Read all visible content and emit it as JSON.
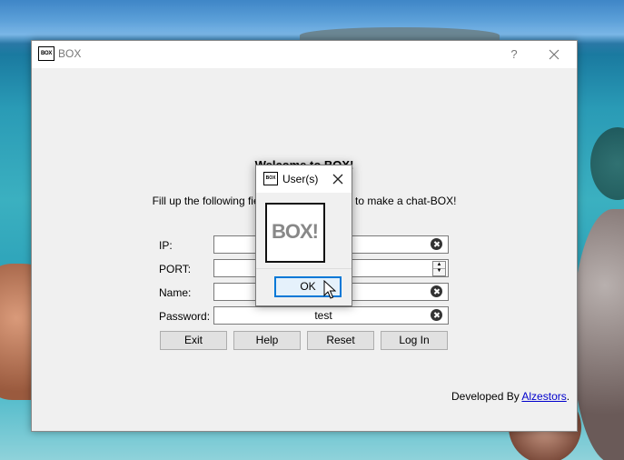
{
  "window": {
    "title": "BOX",
    "icon_label": "BOX",
    "help_label": "?"
  },
  "main": {
    "welcome": "Welcome to BOX!",
    "instructions": "Fill up the following fields and click Log In to make a chat-BOX!",
    "fields": {
      "ip": {
        "label": "IP:",
        "value": ""
      },
      "port": {
        "label": "PORT:",
        "value": ""
      },
      "name": {
        "label": "Name:",
        "value": ""
      },
      "password": {
        "label": "Password:",
        "value": "test"
      }
    },
    "buttons": {
      "exit": "Exit",
      "help": "Help",
      "reset": "Reset",
      "login": "Log In"
    },
    "footer": {
      "prefix": "Developed By ",
      "author": "Alzestors",
      "suffix": "."
    }
  },
  "dialog": {
    "title": "User(s)",
    "icon_label": "BOX",
    "logo_text": "BOX!",
    "ok_label": "OK"
  },
  "colors": {
    "accent": "#0078d7",
    "link": "#0000cc"
  }
}
